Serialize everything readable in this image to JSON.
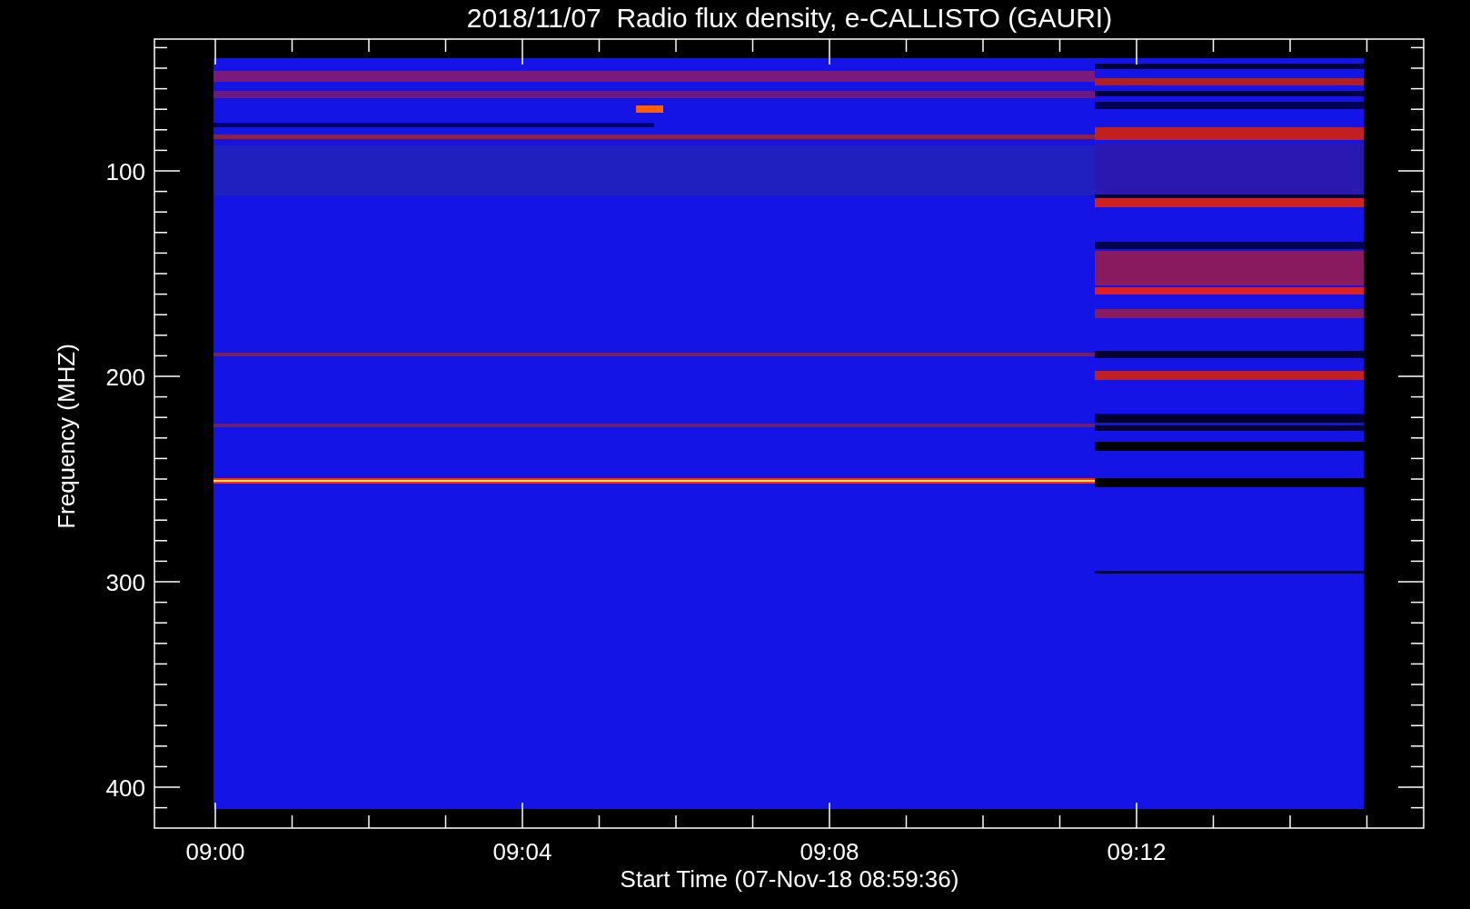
{
  "chart": {
    "title": "2018/11/07  Radio flux density, e-CALLISTO (GAURI)",
    "xlabel": "Start Time (07-Nov-18 08:59:36)",
    "ylabel": "Frequency (MHZ)",
    "xticks": [
      "09:00",
      "09:04",
      "09:08",
      "09:12"
    ],
    "yticks": [
      "100",
      "200",
      "300",
      "400"
    ]
  }
}
